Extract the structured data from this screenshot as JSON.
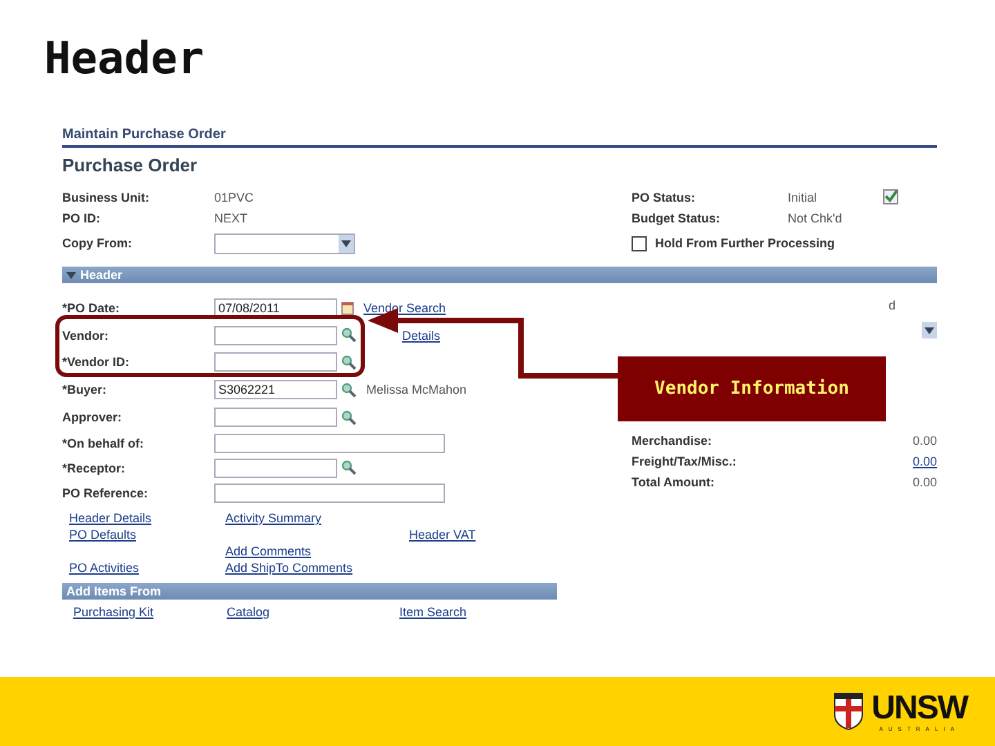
{
  "slide_title": "Header",
  "breadcrumb": "Maintain Purchase Order",
  "page_title": "Purchase Order",
  "info": [
    {
      "label": "Business Unit:",
      "value": "01PVC"
    },
    {
      "label": "PO ID:",
      "value": "NEXT"
    },
    {
      "label": "Copy From:",
      "kind": "dropdown"
    }
  ],
  "status": [
    {
      "label": "PO Status:",
      "value": "Initial"
    },
    {
      "label": "Budget Status:",
      "value": "Not Chk'd"
    }
  ],
  "hold": {
    "label": "Hold From Further Processing",
    "checked": false
  },
  "header_section": {
    "label": "Header",
    "expanded": true
  },
  "fields": [
    {
      "label": "*PO Date:",
      "value": "07/08/2011",
      "kind": "date",
      "link": "Vendor Search"
    },
    {
      "label": "Vendor:",
      "kind": "lookup",
      "link": "Details"
    },
    {
      "label": "*Vendor ID:",
      "kind": "lookup"
    },
    {
      "label": "*Buyer:",
      "value": "S3062221",
      "kind": "lookup",
      "note": "Melissa McMahon"
    },
    {
      "label": "Approver:",
      "kind": "lookup"
    },
    {
      "label": "*On behalf of:",
      "kind": "wide"
    },
    {
      "label": "*Receptor:",
      "kind": "lookup"
    },
    {
      "label": "PO Reference:",
      "kind": "wide"
    }
  ],
  "links": [
    {
      "left": "Header Details",
      "middle": "Activity Summary"
    },
    {
      "left": "PO Defaults",
      "right": "Header VAT"
    },
    {
      "middle": "Add Comments"
    },
    {
      "left": "PO Activities",
      "middle": "Add ShipTo Comments"
    }
  ],
  "right_partial": "d",
  "amounts": [
    {
      "label": "Merchandise:",
      "value": "0.00",
      "link": false
    },
    {
      "label": "Freight/Tax/Misc.:",
      "value": "0.00",
      "link": true
    },
    {
      "label": "Total Amount:",
      "value": "0.00",
      "link": false
    }
  ],
  "add_items": {
    "label": "Add Items From",
    "items": [
      "Purchasing Kit",
      "Catalog",
      "Item Search"
    ]
  },
  "callout": "Vendor Information",
  "logo": {
    "name": "UNSW",
    "sub": "AUSTRALIA"
  }
}
